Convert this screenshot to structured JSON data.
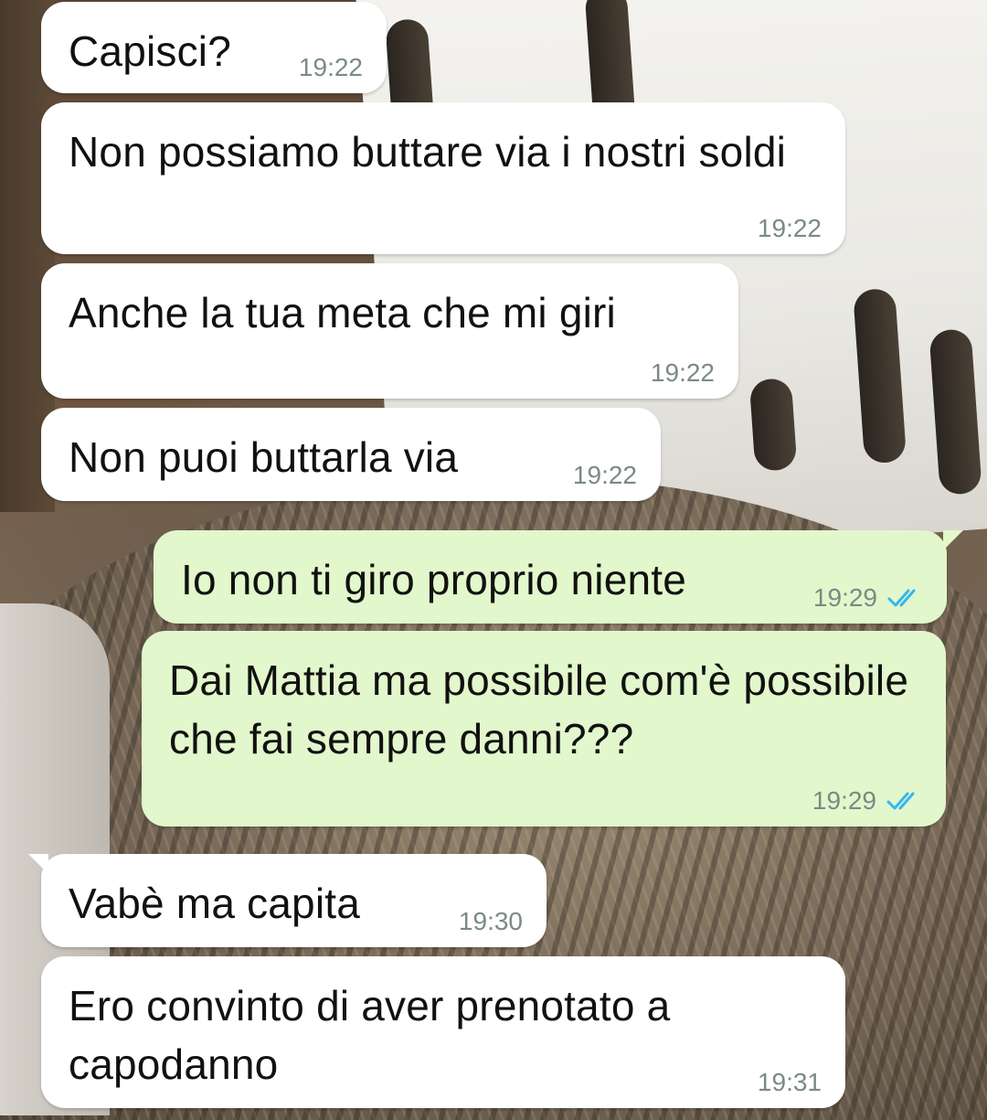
{
  "colors": {
    "incoming_bubble": "#ffffff",
    "outgoing_bubble": "#e2f7cb",
    "timestamp": "#7b8a84",
    "read_ticks": "#34b7f1"
  },
  "messages": [
    {
      "direction": "incoming",
      "text": "Capisci?",
      "time": "19:22"
    },
    {
      "direction": "incoming",
      "text": "Non possiamo buttare via i nostri soldi",
      "time": "19:22"
    },
    {
      "direction": "incoming",
      "text": "Anche la tua meta che mi giri",
      "time": "19:22"
    },
    {
      "direction": "incoming",
      "text": "Non puoi buttarla via",
      "time": "19:22"
    },
    {
      "direction": "outgoing",
      "text": "Io non ti giro proprio niente",
      "time": "19:29",
      "status_icon": "double-check-read-icon"
    },
    {
      "direction": "outgoing",
      "text": "Dai Mattia ma possibile com'è possibile che fai sempre danni???",
      "time": "19:29",
      "status_icon": "double-check-read-icon"
    },
    {
      "direction": "incoming",
      "text": "Vabè ma capita",
      "time": "19:30"
    },
    {
      "direction": "incoming",
      "text": "Ero convinto di aver prenotato a capodanno",
      "time": "19:31"
    }
  ]
}
